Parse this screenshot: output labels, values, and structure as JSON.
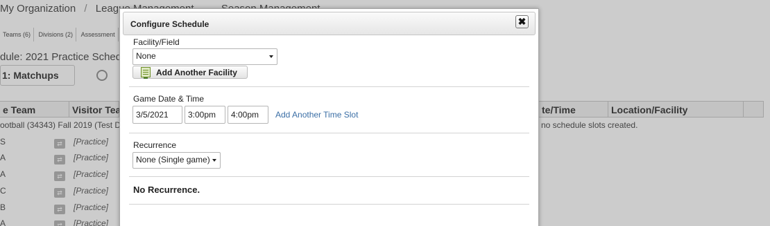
{
  "background": {
    "breadcrumb": [
      "My Organization",
      "/",
      "League Management",
      "→",
      "Season Management"
    ],
    "subtabs": [
      "Teams (6)",
      "Divisions (2)",
      "Assessment"
    ],
    "schedule_title": "dule: 2021 Practice Schedu",
    "step_tab": "1: Matchups",
    "columns": [
      "e Team",
      "Visitor Tea",
      "te/Time",
      "Location/Facility"
    ],
    "rows": [
      {
        "team": "ootball (34343) Fall 2019 (Test D",
        "swap": "",
        "note": ""
      },
      {
        "team": "S",
        "swap": "⇄",
        "note": "[Practice]"
      },
      {
        "team": "A",
        "swap": "⇄",
        "note": "[Practice]"
      },
      {
        "team": "A",
        "swap": "⇄",
        "note": "[Practice]"
      },
      {
        "team": "C",
        "swap": "⇄",
        "note": "[Practice]"
      },
      {
        "team": "B",
        "swap": "⇄",
        "note": "[Practice]"
      },
      {
        "team": "A",
        "swap": "⇄",
        "note": "[Practice]"
      }
    ],
    "empty_message": "no schedule slots created."
  },
  "dialog": {
    "title": "Configure Schedule",
    "close_glyph": "✖",
    "facility": {
      "label": "Facility/Field",
      "selected": "None",
      "add_button": "Add Another Facility"
    },
    "game_date": {
      "label": "Game Date & Time",
      "date": "3/5/2021",
      "start": "3:00pm",
      "end": "4:00pm",
      "add_link": "Add Another Time Slot"
    },
    "recurrence": {
      "label": "Recurrence",
      "selected": "None (Single game)",
      "summary": "No Recurrence."
    }
  },
  "colors": {
    "link": "#3a6ea5",
    "overlay": "rgba(0,0,0,0.2)"
  }
}
